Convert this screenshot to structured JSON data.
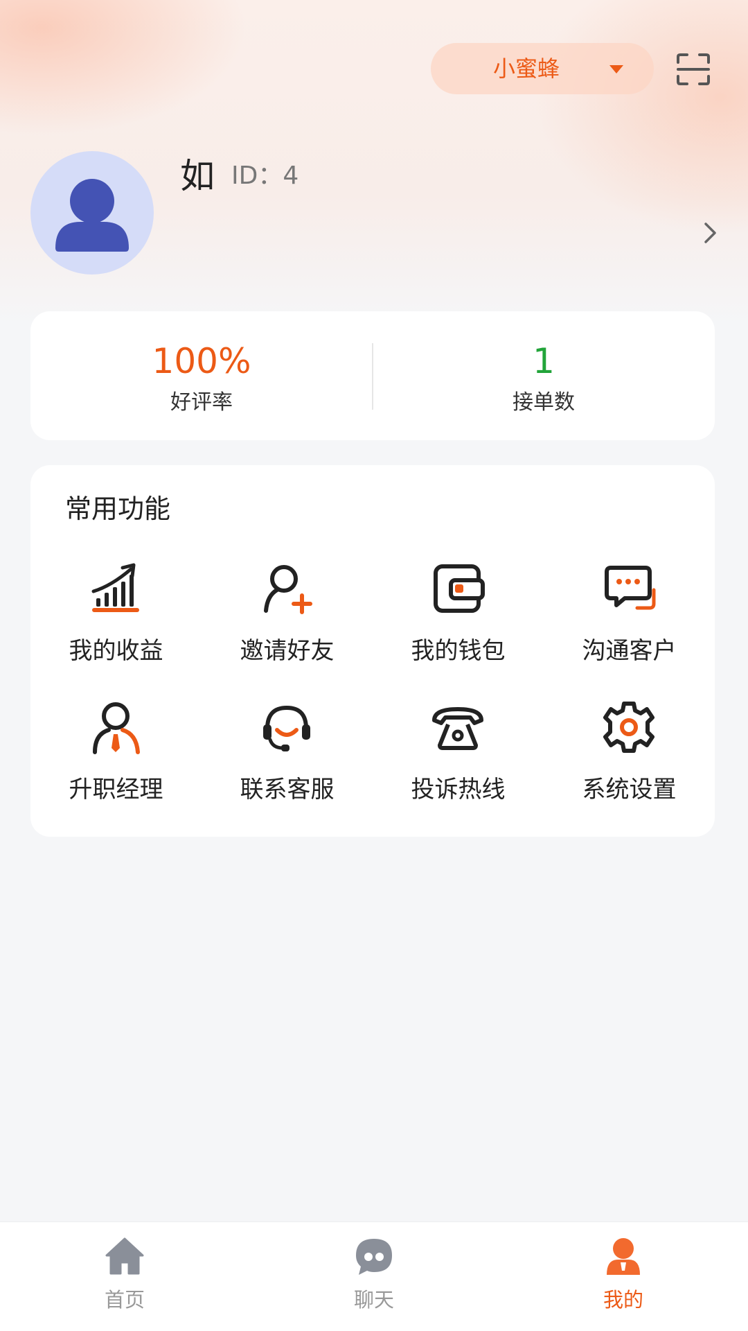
{
  "header": {
    "role_label": "小蜜蜂",
    "role_dropdown_icon": "caret-down-icon",
    "scan_icon": "scan-icon"
  },
  "profile": {
    "name": "如",
    "id_text": "ID：4",
    "avatar_icon": "user-avatar-icon",
    "arrow_icon": "chevron-right-icon"
  },
  "stats": [
    {
      "value": "100%",
      "label": "好评率",
      "color": "#ec5a16"
    },
    {
      "value": "1",
      "label": "接单数",
      "color": "#22a43a"
    }
  ],
  "functions": {
    "title": "常用功能",
    "items": [
      {
        "label": "我的收益",
        "icon": "earnings-chart-icon"
      },
      {
        "label": "邀请好友",
        "icon": "invite-user-icon"
      },
      {
        "label": "我的钱包",
        "icon": "wallet-icon"
      },
      {
        "label": "沟通客户",
        "icon": "chat-icon"
      },
      {
        "label": "升职经理",
        "icon": "manager-icon"
      },
      {
        "label": "联系客服",
        "icon": "customer-service-icon"
      },
      {
        "label": "投诉热线",
        "icon": "telephone-icon"
      },
      {
        "label": "系统设置",
        "icon": "settings-gear-icon"
      }
    ]
  },
  "tabbar": {
    "tabs": [
      {
        "label": "首页",
        "icon": "home-icon",
        "active": false
      },
      {
        "label": "聊天",
        "icon": "chat-bubble-icon",
        "active": false
      },
      {
        "label": "我的",
        "icon": "profile-icon",
        "active": true
      }
    ]
  },
  "colors": {
    "accent": "#ec5a16",
    "success": "#22a43a",
    "avatar": "#4453b4",
    "icon_dark": "#222222",
    "inactive": "#999999"
  }
}
